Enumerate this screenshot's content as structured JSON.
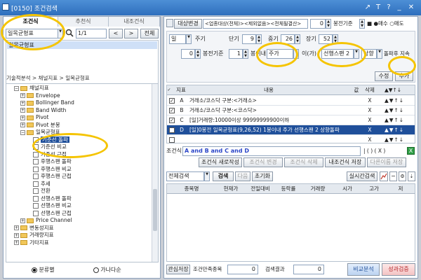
{
  "window": {
    "title": "[0150] 조건검색",
    "buttons": [
      "↗",
      "T",
      "?",
      "_",
      "✕"
    ]
  },
  "left": {
    "tabs": [
      "조건식",
      "추천식",
      "내조건식"
    ],
    "search_value": "일목균형표",
    "page": "1/1",
    "prev": "<",
    "next": ">",
    "all_button": "전체",
    "results": [
      "일목균형표"
    ],
    "breadcrumb": "기술적분석 > 채널지표 > 일목균형표",
    "tree": [
      {
        "level": 1,
        "pm": "−",
        "kind": "folder",
        "label": "채널지표"
      },
      {
        "level": 2,
        "pm": "+",
        "kind": "folder",
        "label": "Envelope"
      },
      {
        "level": 2,
        "pm": "+",
        "kind": "folder",
        "label": "Bollinger Band"
      },
      {
        "level": 2,
        "pm": "+",
        "kind": "folder",
        "label": "Band Width"
      },
      {
        "level": 2,
        "pm": "+",
        "kind": "folder",
        "label": "Pivot"
      },
      {
        "level": 2,
        "pm": "+",
        "kind": "folder",
        "label": "Pivot 분봉"
      },
      {
        "level": 2,
        "pm": "−",
        "kind": "folder",
        "label": "일목균형표"
      },
      {
        "level": 3,
        "pm": "",
        "kind": "doc",
        "label": "기준선 돌파",
        "selected": true
      },
      {
        "level": 3,
        "pm": "",
        "kind": "doc",
        "label": "기준선 비교"
      },
      {
        "level": 3,
        "pm": "",
        "kind": "doc",
        "label": "기준선 근접"
      },
      {
        "level": 3,
        "pm": "",
        "kind": "doc",
        "label": "후행스팬 돌파"
      },
      {
        "level": 3,
        "pm": "",
        "kind": "doc",
        "label": "후행스팬 비교"
      },
      {
        "level": 3,
        "pm": "",
        "kind": "doc",
        "label": "후행스팬 근접"
      },
      {
        "level": 3,
        "pm": "",
        "kind": "doc",
        "label": "추세"
      },
      {
        "level": 3,
        "pm": "",
        "kind": "doc",
        "label": "전환"
      },
      {
        "level": 3,
        "pm": "",
        "kind": "doc",
        "label": "선행스팬 돌파"
      },
      {
        "level": 3,
        "pm": "",
        "kind": "doc",
        "label": "선행스팬 비교"
      },
      {
        "level": 3,
        "pm": "",
        "kind": "doc",
        "label": "선행스팬 근접"
      },
      {
        "level": 2,
        "pm": "+",
        "kind": "folder",
        "label": "Price Channel"
      },
      {
        "level": 1,
        "pm": "+",
        "kind": "folder",
        "label": "변동성지표"
      },
      {
        "level": 1,
        "pm": "+",
        "kind": "folder",
        "label": "거래량지표"
      },
      {
        "level": 1,
        "pm": "+",
        "kind": "folder",
        "label": "기타지표"
      }
    ],
    "radio": [
      {
        "label": "분류별",
        "checked": true
      },
      {
        "label": "가나다순",
        "checked": false
      }
    ]
  },
  "right": {
    "top": {
      "target_button": "대상변경",
      "target_text": "<업종대상(전체)><제외없음><전체될결산>",
      "num": "0",
      "base_label": "봉전기준",
      "stop_label": "■ ●매수 ○매도"
    },
    "params": {
      "period": "일",
      "period_label": "주기",
      "short_label": "단기",
      "short": "9",
      "mid_label": "중기",
      "mid": "26",
      "long_label": "장기",
      "long": "52",
      "base_n": "0",
      "base_label": "봉전기준",
      "bar_n": "1",
      "bar_label": "봉이내",
      "price": "주가",
      "price_suffix": "이(가)",
      "span": "선행스팬 2",
      "dir": "상향",
      "dir_label": "돌파후 지속",
      "edit_button": "수정",
      "add_button": "추가"
    },
    "grid": {
      "headers": [
        "지표",
        "내용",
        "값",
        "삭제",
        "▲▼↑↓"
      ],
      "rows": [
        {
          "id": "A",
          "checked": true,
          "text": "거래소/코스닥 구분:<거래소>",
          "del": "X",
          "arrows": "▲▼↑↓"
        },
        {
          "id": "B",
          "checked": true,
          "text": "거래소/코스닥 구분:<코스닥>",
          "del": "X",
          "arrows": "▲▼↑↓"
        },
        {
          "id": "C",
          "checked": true,
          "text": "[일]거래량:10000이상 99999999900이하",
          "del": "X",
          "arrows": "▲▼↑↓"
        },
        {
          "id": "D",
          "checked": true,
          "text": "[일]0봉전 일목균형표(9,26,52) 1봉이내 주가 선행스팬 2 상향돌파",
          "del": "X",
          "arrows": "▲▼↑↓",
          "selected": true
        },
        {
          "id": "",
          "checked": false,
          "text": "",
          "del": "X",
          "arrows": "▲▼↑↓"
        }
      ]
    },
    "formula": {
      "label": "조건식",
      "value": "A and B and C and D",
      "ops": "| ( ) ( X )"
    },
    "actions": [
      "조건식 새로작성",
      "조건식 변경",
      "조건식 삭제",
      "내조건식 저장",
      "다른이름 저장"
    ],
    "search": {
      "scope": "전체검색",
      "search_btn": "검색",
      "next_btn": "다음",
      "reset_btn": "초기화",
      "realtime_btn": "실시간검색",
      "columns": [
        "종목명",
        "현재가",
        "전일대비",
        "등락률",
        "거래량",
        "시가",
        "고가",
        "저"
      ]
    },
    "bottom": {
      "save_btn": "관심저장",
      "match_label": "조건만족종목",
      "match_value": "0",
      "result_label": "검색결과",
      "result_value": "0",
      "compare_btn": "비교분석",
      "verify_btn": "성과검증"
    }
  },
  "colors": {
    "accent": "#2e6fbd",
    "highlight": "#f5c400",
    "selected_row": "#1f4f9a"
  }
}
